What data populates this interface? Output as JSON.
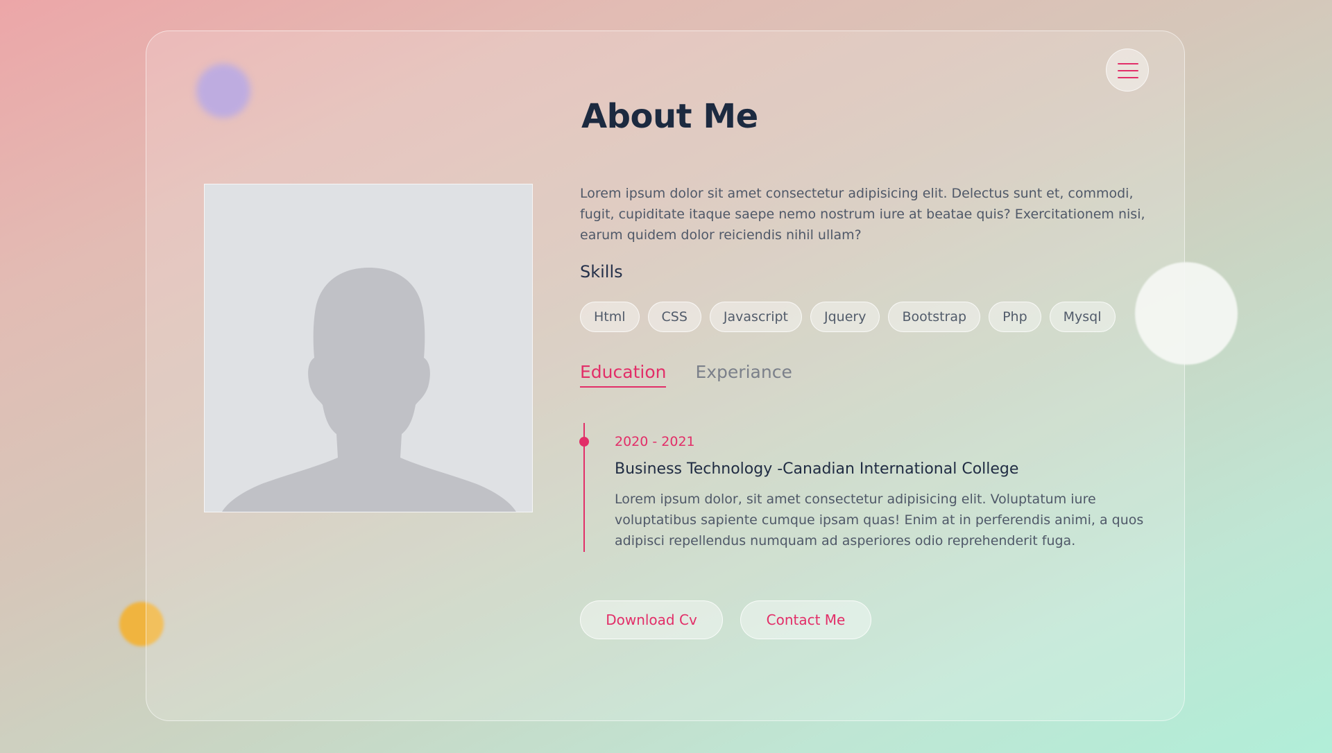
{
  "page": {
    "title": "About Me",
    "intro": "Lorem ipsum dolor sit amet consectetur adipisicing elit. Delectus sunt et, commodi, fugit, cupiditate itaque saepe nemo nostrum iure at beatae quis? Exercitationem nisi, earum quidem dolor reiciendis nihil ullam?"
  },
  "menu": {
    "icon": "hamburger-menu-icon"
  },
  "photo": {
    "icon": "person-silhouette-icon"
  },
  "skills": {
    "heading": "Skills",
    "items": [
      "Html",
      "CSS",
      "Javascript",
      "Jquery",
      "Bootstrap",
      "Php",
      "Mysql"
    ]
  },
  "tabs": [
    {
      "label": "Education",
      "active": true
    },
    {
      "label": "Experiance",
      "active": false
    }
  ],
  "timeline": [
    {
      "date": "2020 - 2021",
      "title": "Business Technology -Canadian International College",
      "description": "Lorem ipsum dolor, sit amet consectetur adipisicing elit. Voluptatum iure voluptatibus sapiente cumque ipsam quas! Enim at in perferendis animi, a quos adipisci repellendus numquam ad asperiores odio reprehenderit fuga."
    }
  ],
  "buttons": {
    "download": "Download Cv",
    "contact": "Contact Me"
  },
  "colors": {
    "accent": "#e22e68",
    "heading": "#1c2a40",
    "body_text": "#4f5868",
    "blob_purple": "#b29ddb",
    "blob_orange": "#f0b43f"
  }
}
